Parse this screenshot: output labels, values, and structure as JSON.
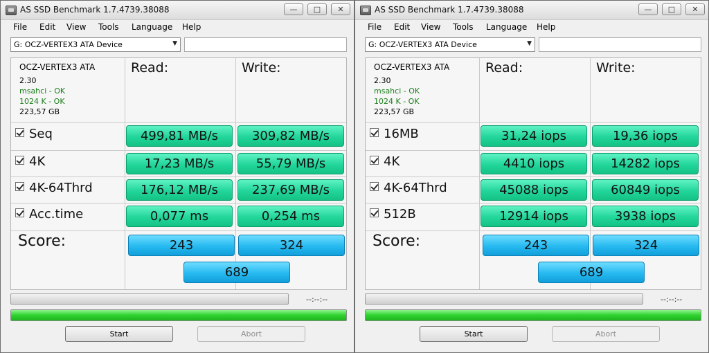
{
  "windows": [
    {
      "title": "AS SSD Benchmark 1.7.4739.38088",
      "menu": [
        "File",
        "Edit",
        "View",
        "Tools",
        "Language",
        "Help"
      ],
      "drive": "G: OCZ-VERTEX3 ATA Device",
      "info": {
        "model": "OCZ-VERTEX3 ATA",
        "firmware": "2.30",
        "driver": "msahci - OK",
        "alignment": "1024 K - OK",
        "size": "223,57 GB"
      },
      "read_header": "Read:",
      "write_header": "Write:",
      "rows": [
        {
          "label": "Seq",
          "read": "499,81 MB/s",
          "write": "309,82 MB/s"
        },
        {
          "label": "4K",
          "read": "17,23 MB/s",
          "write": "55,79 MB/s"
        },
        {
          "label": "4K-64Thrd",
          "read": "176,12 MB/s",
          "write": "237,69 MB/s"
        },
        {
          "label": "Acc.time",
          "read": "0,077 ms",
          "write": "0,254 ms"
        }
      ],
      "score_label": "Score:",
      "score_read": "243",
      "score_write": "324",
      "score_total": "689",
      "time": "--:--:--",
      "current_progress": 0,
      "total_progress": 100,
      "start_label": "Start",
      "abort_label": "Abort"
    },
    {
      "title": "AS SSD Benchmark 1.7.4739.38088",
      "menu": [
        "File",
        "Edit",
        "View",
        "Tools",
        "Language",
        "Help"
      ],
      "drive": "G: OCZ-VERTEX3 ATA Device",
      "info": {
        "model": "OCZ-VERTEX3 ATA",
        "firmware": "2.30",
        "driver": "msahci - OK",
        "alignment": "1024 K - OK",
        "size": "223,57 GB"
      },
      "read_header": "Read:",
      "write_header": "Write:",
      "rows": [
        {
          "label": "16MB",
          "read": "31,24 iops",
          "write": "19,36 iops"
        },
        {
          "label": "4K",
          "read": "4410 iops",
          "write": "14282 iops"
        },
        {
          "label": "4K-64Thrd",
          "read": "45088 iops",
          "write": "60849 iops"
        },
        {
          "label": "512B",
          "read": "12914 iops",
          "write": "3938 iops"
        }
      ],
      "score_label": "Score:",
      "score_read": "243",
      "score_write": "324",
      "score_total": "689",
      "time": "--:--:--",
      "current_progress": 0,
      "total_progress": 100,
      "start_label": "Start",
      "abort_label": "Abort"
    }
  ]
}
